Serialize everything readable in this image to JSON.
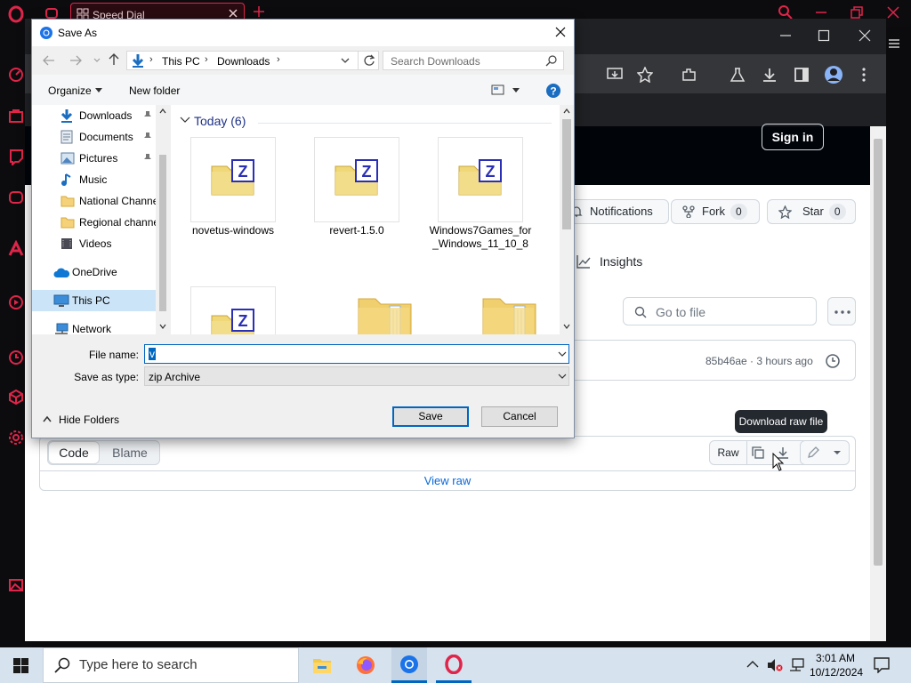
{
  "opera": {
    "tab_label": "Speed Dial"
  },
  "github": {
    "sign_in": "Sign in",
    "notifications": "Notifications",
    "fork": {
      "label": "Fork",
      "count": "0"
    },
    "star": {
      "label": "Star",
      "count": "0"
    },
    "insights": "Insights",
    "go_to_file": "Go to file",
    "commit": "85b46ae · 3 hours ago",
    "code_tab": "Code",
    "blame_tab": "Blame",
    "raw_button": "Raw",
    "view_raw": "View raw",
    "tooltip": "Download raw file"
  },
  "dialog": {
    "title": "Save As",
    "breadcrumb": [
      "This PC",
      "Downloads"
    ],
    "search_placeholder": "Search Downloads",
    "organize": "Organize",
    "new_folder": "New folder",
    "nav_items": [
      {
        "label": "Downloads",
        "icon": "download-arrow-icon",
        "pinned": true
      },
      {
        "label": "Documents",
        "icon": "document-icon",
        "pinned": true
      },
      {
        "label": "Pictures",
        "icon": "pictures-icon",
        "pinned": true
      },
      {
        "label": "Music",
        "icon": "music-icon",
        "pinned": false
      },
      {
        "label": "National Channe",
        "icon": "folder-icon",
        "pinned": false
      },
      {
        "label": "Regional channe",
        "icon": "folder-icon",
        "pinned": false
      },
      {
        "label": "Videos",
        "icon": "videos-icon",
        "pinned": false
      },
      {
        "label": "OneDrive",
        "icon": "cloud-icon",
        "pinned": false
      },
      {
        "label": "This PC",
        "icon": "pc-icon",
        "pinned": false
      },
      {
        "label": "Network",
        "icon": "network-icon",
        "pinned": false
      }
    ],
    "group_header": "Today (6)",
    "files": [
      {
        "name": "novetus-windows",
        "type": "zip"
      },
      {
        "name": "revert-1.5.0",
        "type": "zip"
      },
      {
        "name": "Windows7Games_for_Windows_11_10_8",
        "type": "zip"
      },
      {
        "name": "",
        "type": "zip"
      },
      {
        "name": "",
        "type": "folder"
      },
      {
        "name": "",
        "type": "folder"
      }
    ],
    "file_name_label": "File name:",
    "file_name_value": "v",
    "save_as_type_label": "Save as type:",
    "save_as_type_value": "zip Archive",
    "hide_folders": "Hide Folders",
    "save_button": "Save",
    "cancel_button": "Cancel"
  },
  "taskbar": {
    "search_placeholder": "Type here to search",
    "time": "3:01 AM",
    "date": "10/12/2024"
  },
  "colors": {
    "opera_red": "#e0254a",
    "github_dark": "#010409",
    "accent_blue": "#0067c0"
  }
}
